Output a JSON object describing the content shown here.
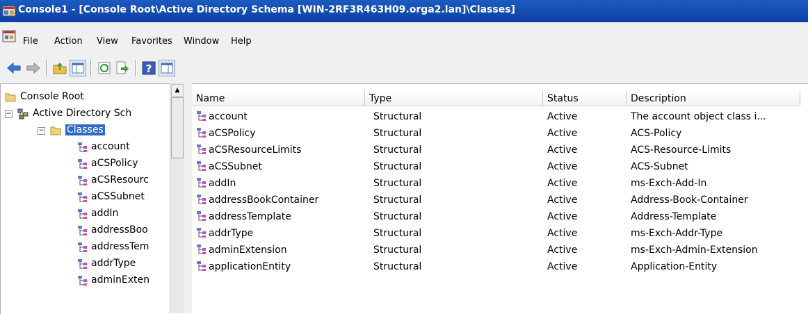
{
  "window": {
    "title": "Console1 - [Console Root\\Active Directory Schema [WIN-2RF3R463H09.orga2.lan]\\Classes]"
  },
  "menu": [
    "File",
    "Action",
    "View",
    "Favorites",
    "Window",
    "Help"
  ],
  "toolbar": {
    "buttons": [
      "back-icon",
      "forward-icon",
      "up-folder-icon",
      "show-hide-tree-icon",
      "refresh-icon",
      "export-list-icon",
      "help-icon",
      "show-hide-action-pane-icon"
    ]
  },
  "tree": {
    "root": "Console Root",
    "snapin": "Active Directory Sch",
    "folder": "Classes",
    "items": [
      "account",
      "aCSPolicy",
      "aCSResourc",
      "aCSSubnet",
      "addIn",
      "addressBoo",
      "addressTem",
      "addrType",
      "adminExten"
    ]
  },
  "list": {
    "columns": [
      "Name",
      "Type",
      "Status",
      "Description"
    ],
    "rows": [
      {
        "name": "account",
        "type": "Structural",
        "status": "Active",
        "description": "The account object class i..."
      },
      {
        "name": "aCSPolicy",
        "type": "Structural",
        "status": "Active",
        "description": "ACS-Policy"
      },
      {
        "name": "aCSResourceLimits",
        "type": "Structural",
        "status": "Active",
        "description": "ACS-Resource-Limits"
      },
      {
        "name": "aCSSubnet",
        "type": "Structural",
        "status": "Active",
        "description": "ACS-Subnet"
      },
      {
        "name": "addIn",
        "type": "Structural",
        "status": "Active",
        "description": "ms-Exch-Add-In"
      },
      {
        "name": "addressBookContainer",
        "type": "Structural",
        "status": "Active",
        "description": "Address-Book-Container"
      },
      {
        "name": "addressTemplate",
        "type": "Structural",
        "status": "Active",
        "description": "Address-Template"
      },
      {
        "name": "addrType",
        "type": "Structural",
        "status": "Active",
        "description": "ms-Exch-Addr-Type"
      },
      {
        "name": "adminExtension",
        "type": "Structural",
        "status": "Active",
        "description": "ms-Exch-Admin-Extension"
      },
      {
        "name": "applicationEntity",
        "type": "Structural",
        "status": "Active",
        "description": "Application-Entity"
      }
    ]
  },
  "colors": {
    "titlebar": "#0a3fa6",
    "selection": "#3169c6"
  }
}
